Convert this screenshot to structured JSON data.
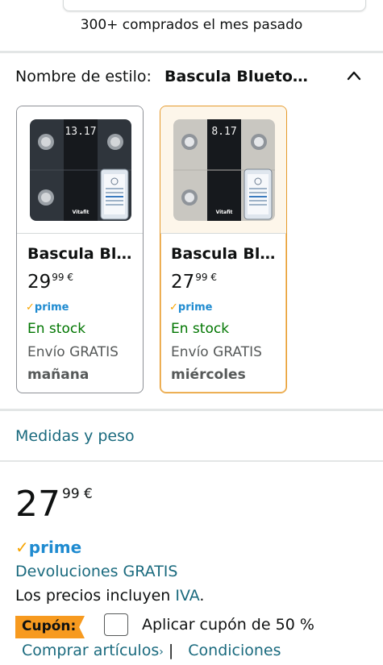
{
  "header": {
    "bought_text": "300+ comprados el mes pasado"
  },
  "style_selector": {
    "label": "Nombre de estilo:",
    "value": "Bascula Blueto…"
  },
  "variants": [
    {
      "title": "Bascula Bl…",
      "price_whole": "29",
      "price_fraction": "99",
      "currency": "€",
      "prime": "prime",
      "stock": "En stock",
      "shipping": "Envío GRATIS",
      "delivery_day": "mañana",
      "device_color": "#2f353c",
      "display_digits": "13.17",
      "logo": "Vitafit"
    },
    {
      "title": "Bascula Bl…",
      "price_whole": "27",
      "price_fraction": "99",
      "currency": "€",
      "prime": "prime",
      "stock": "En stock",
      "shipping": "Envío GRATIS",
      "delivery_day": "miércoles",
      "device_color": "#c9c7c1",
      "display_digits": "8.17",
      "logo": "Vitafit"
    }
  ],
  "measures_link": "Medidas y peso",
  "buybox": {
    "price_whole": "27",
    "price_fraction": "99",
    "currency": "€",
    "prime": "prime",
    "returns": "Devoluciones GRATIS",
    "vat_prefix": "Los precios incluyen ",
    "vat_link": "IVA",
    "vat_suffix": ".",
    "coupon_label": "Cupón:",
    "coupon_text": "Aplicar cupón de 50 %",
    "shop_link": "Comprar artículos",
    "conditions_link": "Condiciones"
  },
  "colors": {
    "link": "#1a6a7e",
    "prime": "#1f8bd0",
    "stock": "#007600",
    "coupon": "#f79a1f",
    "selected_border": "#e69a2b"
  }
}
